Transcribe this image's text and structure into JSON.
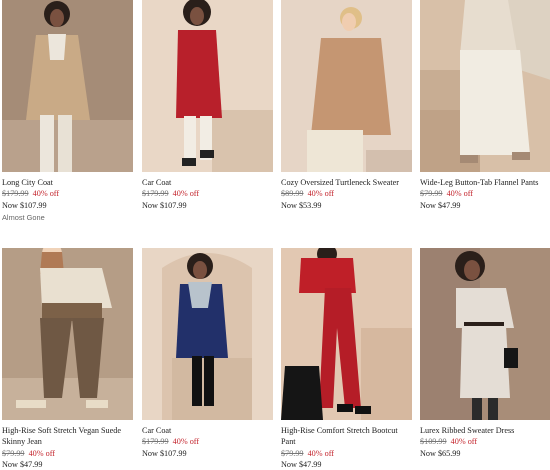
{
  "products": [
    {
      "name": "Long City Coat",
      "was": "$179.99",
      "pct": "40% off",
      "now": "Now $107.99",
      "note": "Almost Gone"
    },
    {
      "name": "Car Coat",
      "was": "$179.99",
      "pct": "40% off",
      "now": "Now $107.99",
      "note": ""
    },
    {
      "name": "Cozy Oversized Turtleneck Sweater",
      "was": "$89.99",
      "pct": "40% off",
      "now": "Now $53.99",
      "note": ""
    },
    {
      "name": "Wide-Leg Button-Tab Flannel Pants",
      "was": "$79.99",
      "pct": "40% off",
      "now": "Now $47.99",
      "note": ""
    },
    {
      "name": "High-Rise Soft Stretch Vegan Suede Skinny Jean",
      "was": "$79.99",
      "pct": "40% off",
      "now": "Now $47.99",
      "note": ""
    },
    {
      "name": "Car Coat",
      "was": "$179.99",
      "pct": "40% off",
      "now": "Now $107.99",
      "note": ""
    },
    {
      "name": "High-Rise Comfort Stretch Bootcut Pant",
      "was": "$79.99",
      "pct": "40% off",
      "now": "Now $47.99",
      "note": ""
    },
    {
      "name": "Lurex Ribbed Sweater Dress",
      "was": "$109.99",
      "pct": "40% off",
      "now": "Now $65.99",
      "note": ""
    }
  ],
  "colors": {
    "sale": "#c4262e",
    "was": "#777777",
    "text": "#222222"
  }
}
